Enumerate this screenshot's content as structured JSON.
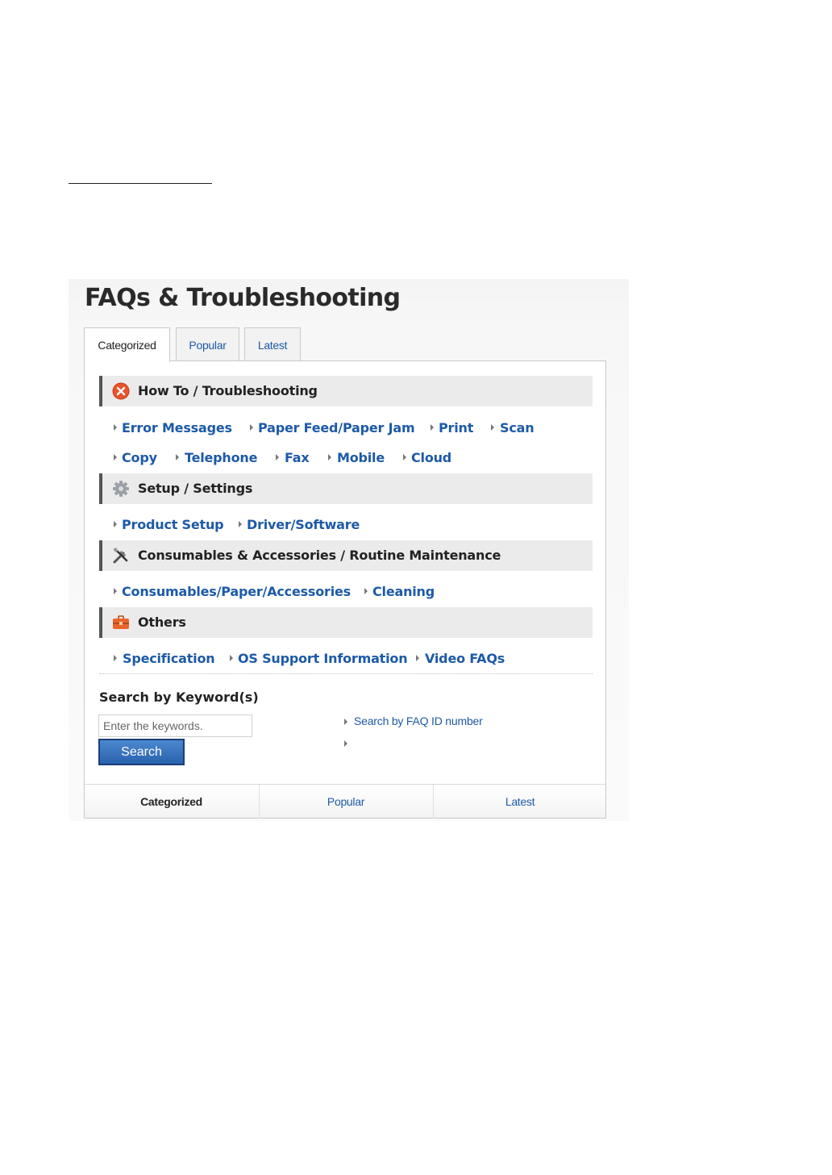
{
  "panel": {
    "title": "FAQs & Troubleshooting"
  },
  "tabs": [
    {
      "label": "Categorized",
      "active": true
    },
    {
      "label": "Popular",
      "active": false
    },
    {
      "label": "Latest",
      "active": false
    }
  ],
  "sections": [
    {
      "label": "How To / Troubleshooting",
      "icon": "error-circle-icon",
      "links": [
        "Error Messages",
        "Paper Feed/Paper Jam",
        "Print",
        "Scan",
        "Copy",
        "Telephone",
        "Fax",
        "Mobile",
        "Cloud"
      ]
    },
    {
      "label": "Setup / Settings",
      "icon": "gear-icon",
      "links": [
        "Product Setup",
        "Driver/Software"
      ]
    },
    {
      "label": "Consumables & Accessories / Routine Maintenance",
      "icon": "tools-icon",
      "links": [
        "Consumables/Paper/Accessories",
        "Cleaning"
      ]
    },
    {
      "label": "Others",
      "icon": "toolbox-icon",
      "links": [
        "Specification",
        "OS Support Information",
        "Video FAQs"
      ]
    }
  ],
  "search": {
    "title": "Search by Keyword(s)",
    "placeholder": "Enter the keywords.",
    "button": "Search",
    "faq_id_link": "Search by FAQ ID number"
  },
  "footer_tabs": [
    {
      "label": "Categorized",
      "active": true
    },
    {
      "label": "Popular",
      "active": false
    },
    {
      "label": "Latest",
      "active": false
    }
  ],
  "colors": {
    "link": "#1d5aa8",
    "error_icon": "#e8542b",
    "button": "#2a63ad",
    "section_bar": "#ebebeb"
  }
}
